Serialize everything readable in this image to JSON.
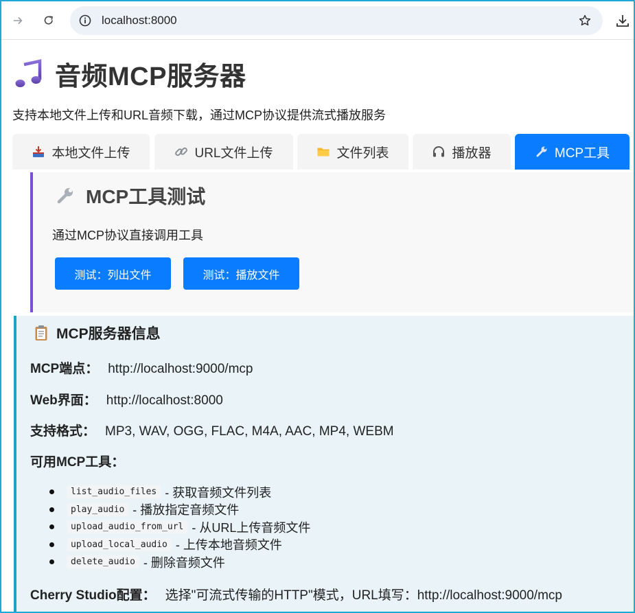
{
  "browser": {
    "url": "localhost:8000",
    "icons": [
      "forward-icon",
      "reload-icon",
      "info-icon",
      "star-icon",
      "download-icon"
    ]
  },
  "header": {
    "title": "音频MCP服务器",
    "subtitle": "支持本地文件上传和URL音频下载，通过MCP协议提供流式播放服务"
  },
  "tabs": [
    {
      "label": "本地文件上传",
      "icon": "inbox-tray-icon",
      "active": false
    },
    {
      "label": "URL文件上传",
      "icon": "link-icon",
      "active": false
    },
    {
      "label": "文件列表",
      "icon": "folder-icon",
      "active": false
    },
    {
      "label": "播放器",
      "icon": "headphones-icon",
      "active": false
    },
    {
      "label": "MCP工具",
      "icon": "wrench-icon",
      "active": true
    }
  ],
  "mcp_panel": {
    "title": "MCP工具测试",
    "description": "通过MCP协议直接调用工具",
    "buttons": {
      "list": "测试：列出文件",
      "play": "测试：播放文件"
    }
  },
  "server_info": {
    "title": "MCP服务器信息",
    "endpoint_label": "MCP端点：",
    "endpoint_value": "http://localhost:9000/mcp",
    "web_label": "Web界面：",
    "web_value": "http://localhost:8000",
    "formats_label": "支持格式：",
    "formats_value": "MP3, WAV, OGG, FLAC, M4A, AAC, MP4, WEBM",
    "tools_label": "可用MCP工具：",
    "tools": [
      {
        "name": "list_audio_files",
        "desc": "- 获取音频文件列表"
      },
      {
        "name": "play_audio",
        "desc": "- 播放指定音频文件"
      },
      {
        "name": "upload_audio_from_url",
        "desc": "- 从URL上传音频文件"
      },
      {
        "name": "upload_local_audio",
        "desc": "- 上传本地音频文件"
      },
      {
        "name": "delete_audio",
        "desc": "- 删除音频文件"
      }
    ],
    "cherry_label": "Cherry Studio配置：",
    "cherry_value": "选择\"可流式传输的HTTP\"模式，URL填写：http://localhost:9000/mcp"
  },
  "colors": {
    "accent_blue": "#0a7cff",
    "panel_purple": "#7b4fd6",
    "info_bar": "#1aa4c8",
    "info_bg": "#e9f3f8"
  }
}
